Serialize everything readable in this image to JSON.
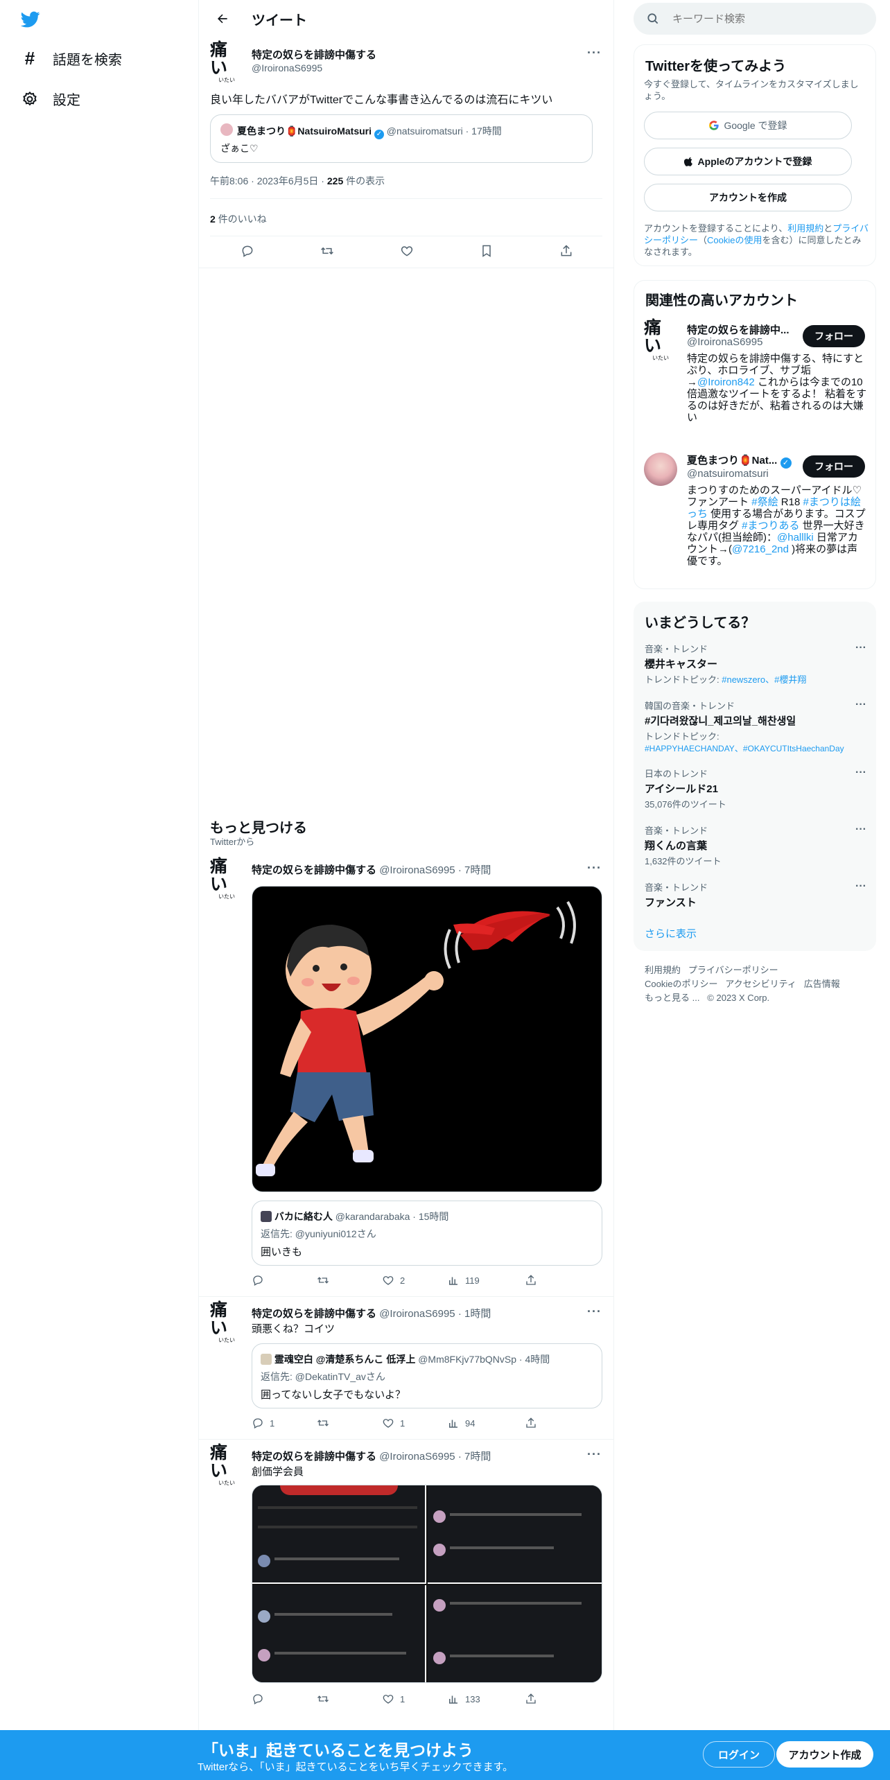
{
  "nav": {
    "explore_label": "話題を検索",
    "settings_label": "設定"
  },
  "header": {
    "title": "ツイート"
  },
  "tweet": {
    "avatar_big": "痛い",
    "avatar_small": "いたい",
    "name": "特定の奴らを誹謗中傷する",
    "handle": "@IroironaS6995",
    "text": "良い年したババアがTwitterでこんな事書き込んでるのは流石にキツい",
    "quote": {
      "name": "夏色まつり🏮NatsuiroMatsuri",
      "handle": "@natsuiromatsuri",
      "time": "17時間",
      "text": "ざぁこ♡"
    },
    "time": "午前8:06",
    "date": "2023年6月5日",
    "views_count": "225",
    "views_label": "件の表示",
    "likes_count": "2",
    "likes_label": "件のいいね"
  },
  "discover": {
    "title": "もっと見つける",
    "subtitle": "Twitterから"
  },
  "feed": [
    {
      "name": "特定の奴らを誹謗中傷する",
      "handle": "@IroironaS6995",
      "time": "7時間",
      "quote_name": "バカに絡む人",
      "quote_handle": "@karandarabaka",
      "quote_time": "15時間",
      "quote_reply_prefix": "返信先: ",
      "quote_reply_to": "@yuniyuni012さん",
      "quote_text": "囲いきも",
      "likes": "2",
      "views": "119"
    },
    {
      "name": "特定の奴らを誹謗中傷する",
      "handle": "@IroironaS6995",
      "time": "1時間",
      "text": "頭悪くね？コイツ",
      "quote_name": "霊魂空白 @清楚系ちんこ 低浮上",
      "quote_handle": "@Mm8FKjv77bQNvSp",
      "quote_time": "4時間",
      "quote_reply_prefix": "返信先: ",
      "quote_reply_to": "@DekatinTV_avさん",
      "quote_text": "囲ってないし女子でもないよ？",
      "replies": "1",
      "likes": "1",
      "views": "94"
    },
    {
      "name": "特定の奴らを誹謗中傷する",
      "handle": "@IroironaS6995",
      "time": "7時間",
      "text": "創価学会員",
      "likes": "1",
      "views": "133"
    }
  ],
  "search": {
    "placeholder": "キーワード検索"
  },
  "signup_card": {
    "title": "Twitterを使ってみよう",
    "subtitle": "今すぐ登録して、タイムラインをカスタマイズしましょう。",
    "google_label": "Google で登録",
    "apple_label": "Appleのアカウントで登録",
    "create_label": "アカウントを作成",
    "terms_prefix": "アカウントを登録することにより、",
    "terms_link": "利用規約",
    "terms_and": "と",
    "privacy_link": "プライバシーポリシー",
    "cookie_open": "（",
    "cookie_link": "Cookieの使用",
    "cookie_suffix": "を含む）に同意したとみなされます。"
  },
  "related": {
    "title": "関連性の高いアカウント",
    "follow_label": "フォロー",
    "accounts": [
      {
        "name": "特定の奴らを誹謗中...",
        "handle": "@IroironaS6995",
        "bio_1": "特定の奴らを誹謗中傷する、特にすとぷり、ホロライブ、サブ垢→",
        "bio_link": "@Iroiron842",
        "bio_2": " これからは今までの10倍過激なツイートをするよ！ 粘着をするのは好きだが、粘着されるのは大嫌い"
      },
      {
        "name": "夏色まつり🏮Nat...",
        "handle": "@natsuiromatsuri",
        "bio_1": "まつりすのためのスーパーアイドル♡ファンアート ",
        "tag_1": "#祭絵",
        "bio_2": " R18 ",
        "tag_2": "#まつりは絵っち",
        "bio_3": " 使用する場合があります。コスプレ専用タグ ",
        "tag_3": "#まつりある",
        "bio_4": " 世界一大好きなパパ(担当絵師)：",
        "tag_4": "@halllki",
        "bio_5": " 日常アカウント→(",
        "tag_5": "@7216_2nd",
        "bio_6": " )将来の夢は声優です。"
      }
    ]
  },
  "trends": {
    "title": "いまどうしてる？",
    "items": [
      {
        "category": "音楽・トレンド",
        "name": "櫻井キャスター",
        "sub_prefix": "トレンドトピック: ",
        "sub_link": "#newszero、#櫻井翔"
      },
      {
        "category": "韓国の音楽・トレンド",
        "name": "#기다려왔잖니_제고의날_해찬생일",
        "sub_prefix": "トレンドトピック: ",
        "sub_link": "#HAPPYHAECHANDAY、#OKAYCUTItsHaechanDay"
      },
      {
        "category": "日本のトレンド",
        "name": "アイシールド21",
        "sub": "35,076件のツイート"
      },
      {
        "category": "音楽・トレンド",
        "name": "翔くんの言葉",
        "sub": "1,632件のツイート"
      },
      {
        "category": "音楽・トレンド",
        "name": "ファンスト"
      }
    ],
    "show_more": "さらに表示"
  },
  "footer": {
    "terms": "利用規約",
    "privacy": "プライバシーポリシー",
    "cookie": "Cookieのポリシー",
    "accessibility": "アクセシビリティ",
    "ads": "広告情報",
    "more": "もっと見る ...",
    "copyright": "© 2023 X Corp."
  },
  "bottom": {
    "headline": "「いま」起きていることを見つけよう",
    "sub": "Twitterなら、「いま」起きていることをいち早くチェックできます。",
    "login": "ログイン",
    "signup": "アカウント作成"
  },
  "colors": {
    "accent": "#1d9bf0",
    "text": "#0f1419",
    "muted": "#536471"
  }
}
